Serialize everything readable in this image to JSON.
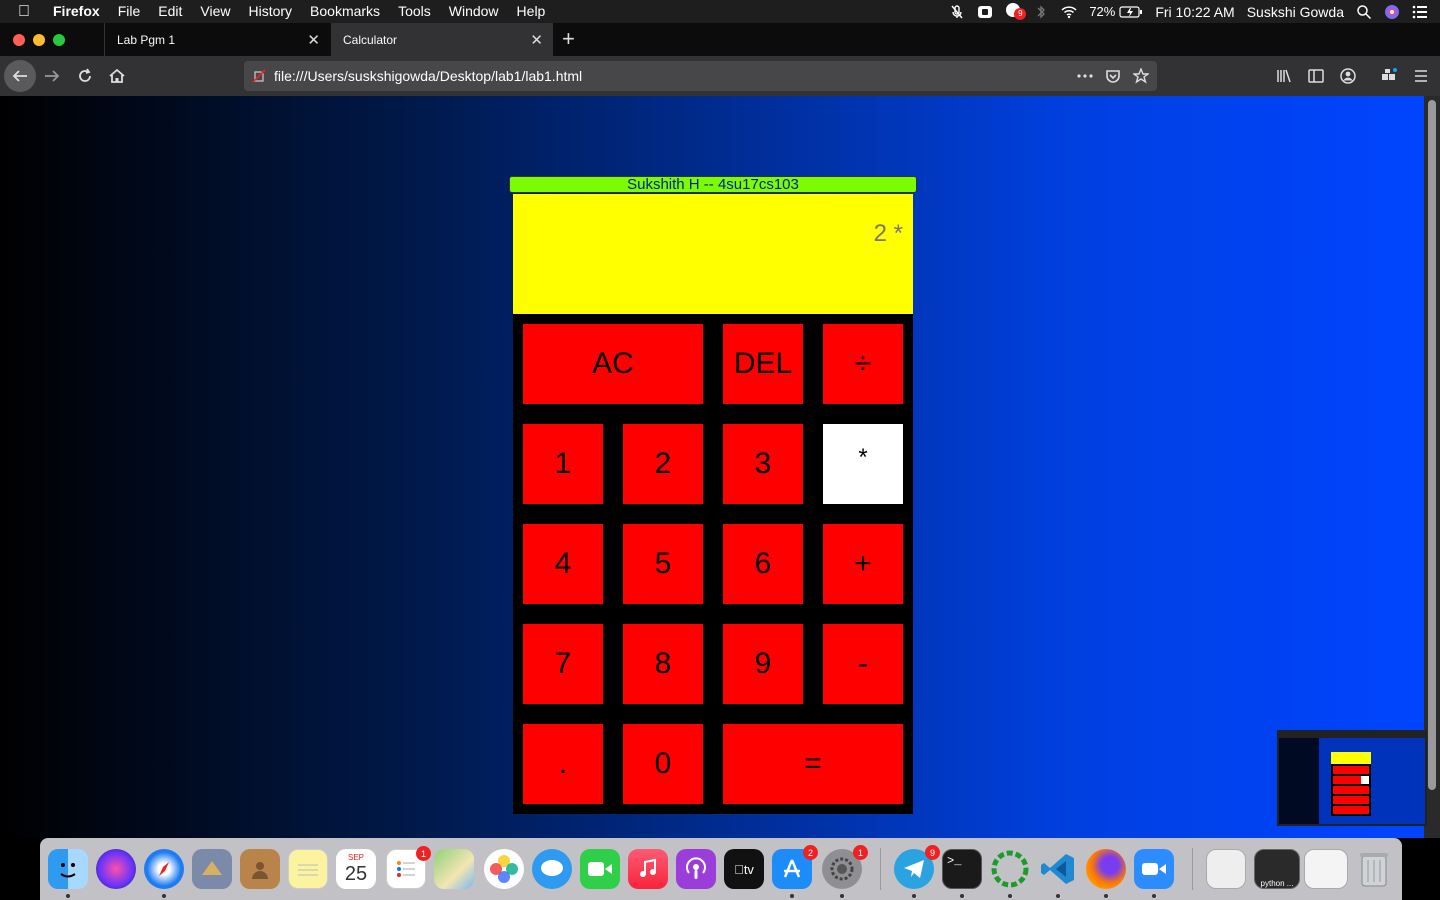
{
  "menubar": {
    "app_name": "Firefox",
    "items": [
      "File",
      "Edit",
      "View",
      "History",
      "Bookmarks",
      "Tools",
      "Window",
      "Help"
    ],
    "battery": "72%",
    "clock": "Fri 10:22 AM",
    "user": "Suskshi Gowda",
    "notification_badge": "9"
  },
  "browser": {
    "tabs": [
      {
        "label": "Lab Pgm 1"
      },
      {
        "label": "Calculator"
      }
    ],
    "url": "file:///Users/suskshigowda/Desktop/lab1/lab1.html"
  },
  "calculator": {
    "title": "Sukshith H -- 4su17cs103",
    "display": "2 *",
    "keys": {
      "ac": "AC",
      "del": "DEL",
      "divide": "÷",
      "k1": "1",
      "k2": "2",
      "k3": "3",
      "multiply": "*",
      "k4": "4",
      "k5": "5",
      "k6": "6",
      "plus": "+",
      "k7": "7",
      "k8": "8",
      "k9": "9",
      "minus": "-",
      "dot": ".",
      "k0": "0",
      "equals": "="
    },
    "colors": {
      "display": "#ffff00",
      "key": "#ff0000",
      "active_key": "#ffffff",
      "title_bar": "#7cfc00"
    }
  },
  "dock": {
    "calendar_month": "SEP",
    "calendar_day": "25",
    "reminders_badge": "1",
    "appstore_badge": "2",
    "settings_badge": "1",
    "telegram_badge": "9",
    "python_label": "python ..."
  }
}
